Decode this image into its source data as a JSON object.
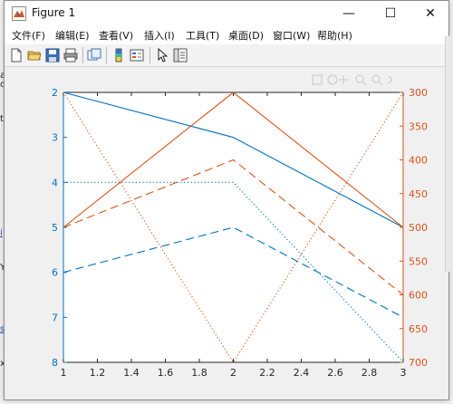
{
  "window": {
    "title": "Figure 1",
    "minimize_glyph": "—",
    "maximize_glyph": "☐",
    "close_glyph": "✕"
  },
  "menu": [
    {
      "label": "文件(F)"
    },
    {
      "label": "编辑(E)"
    },
    {
      "label": "查看(V)"
    },
    {
      "label": "插入(I)"
    },
    {
      "label": "工具(T)"
    },
    {
      "label": "桌面(D)"
    },
    {
      "label": "窗口(W)"
    },
    {
      "label": "帮助(H)"
    }
  ],
  "toolbar": {
    "icons": [
      "new-figure-icon",
      "open-file-icon",
      "save-icon",
      "print-icon",
      "link-plot-icon",
      "insert-colorbar-icon",
      "insert-legend-icon",
      "pointer-icon",
      "property-editor-icon"
    ]
  },
  "background_fragments": [
    "a",
    "cs",
    "t",
    "i",
    "Y",
    "s",
    "x"
  ],
  "colors": {
    "left_axis": "#0072BD",
    "right_axis": "#D95319",
    "axis_text": "#262626"
  },
  "chart_data": {
    "type": "line",
    "title": "",
    "xlabel": "",
    "ylabel": "",
    "xlim": [
      1,
      3
    ],
    "x_ticks": [
      "1",
      "1.2",
      "1.4",
      "1.6",
      "1.8",
      "2",
      "2.2",
      "2.4",
      "2.6",
      "2.8",
      "3"
    ],
    "left_axis": {
      "ylim": [
        2,
        8
      ],
      "reversed": true,
      "ticks": [
        "2",
        "3",
        "4",
        "5",
        "6",
        "7",
        "8"
      ],
      "series": [
        {
          "style": "solid",
          "x": [
            1,
            2,
            3
          ],
          "y": [
            2,
            3,
            5
          ]
        },
        {
          "style": "dotted",
          "x": [
            1,
            2,
            3
          ],
          "y": [
            4,
            4,
            8
          ]
        },
        {
          "style": "dashed",
          "x": [
            1,
            2,
            3
          ],
          "y": [
            6,
            5,
            7
          ]
        }
      ]
    },
    "right_axis": {
      "ylim": [
        300,
        700
      ],
      "reversed": true,
      "ticks": [
        "300",
        "350",
        "400",
        "450",
        "500",
        "550",
        "600",
        "650",
        "700"
      ],
      "series": [
        {
          "style": "solid",
          "x": [
            1,
            2,
            3
          ],
          "y": [
            500,
            300,
            500
          ]
        },
        {
          "style": "dotted",
          "x": [
            1,
            2,
            3
          ],
          "y": [
            300,
            700,
            300
          ]
        },
        {
          "style": "dashed",
          "x": [
            1,
            2,
            3
          ],
          "y": [
            500,
            400,
            600
          ]
        }
      ]
    },
    "grid": false,
    "legend": "none"
  }
}
